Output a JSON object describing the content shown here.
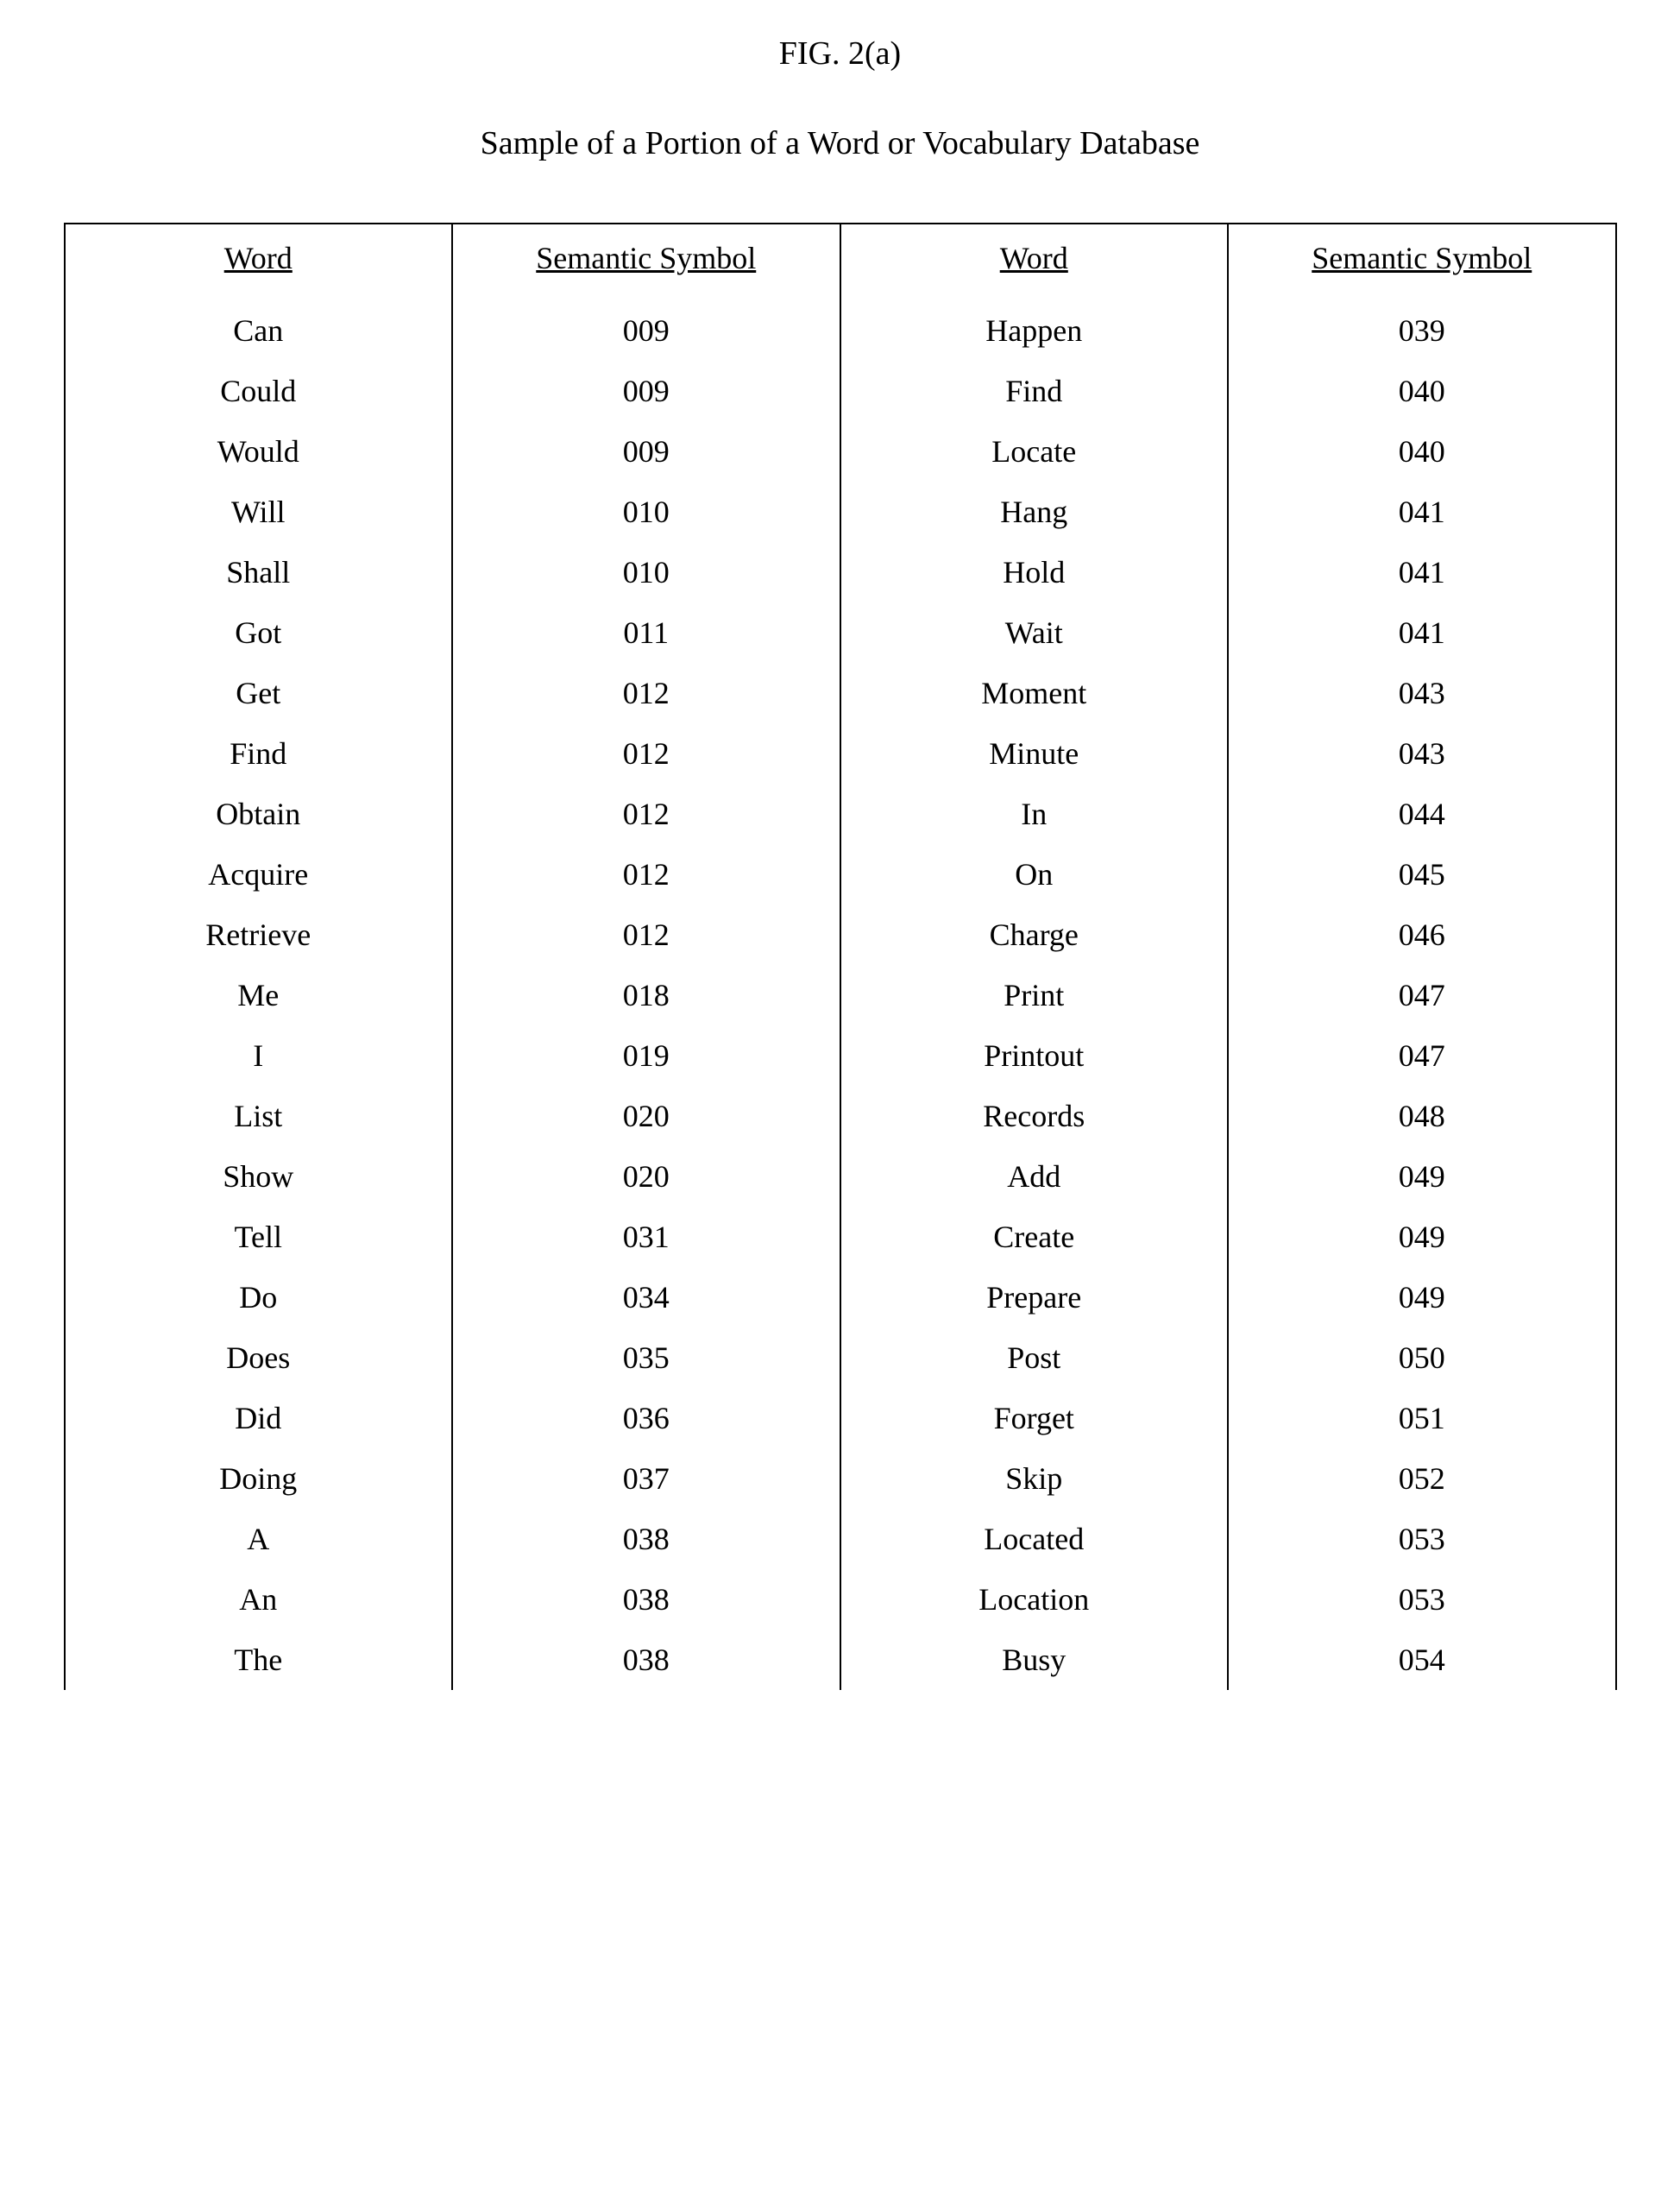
{
  "figure_label": "FIG. 2(a)",
  "title": "Sample of a Portion of a Word or Vocabulary Database",
  "headers": {
    "word_left": "Word",
    "symbol_left": "Semantic Symbol",
    "word_right": "Word",
    "symbol_right": "Semantic Symbol"
  },
  "rows": [
    {
      "w1": "Can",
      "s1": "009",
      "w2": "Happen",
      "s2": "039"
    },
    {
      "w1": "Could",
      "s1": "009",
      "w2": "Find",
      "s2": "040"
    },
    {
      "w1": "Would",
      "s1": "009",
      "w2": "Locate",
      "s2": "040"
    },
    {
      "w1": "Will",
      "s1": "010",
      "w2": "Hang",
      "s2": "041"
    },
    {
      "w1": "Shall",
      "s1": "010",
      "w2": "Hold",
      "s2": "041"
    },
    {
      "w1": "Got",
      "s1": "011",
      "w2": "Wait",
      "s2": "041"
    },
    {
      "w1": "Get",
      "s1": "012",
      "w2": "Moment",
      "s2": "043"
    },
    {
      "w1": "Find",
      "s1": "012",
      "w2": "Minute",
      "s2": "043"
    },
    {
      "w1": "Obtain",
      "s1": "012",
      "w2": "In",
      "s2": "044"
    },
    {
      "w1": "Acquire",
      "s1": "012",
      "w2": "On",
      "s2": "045"
    },
    {
      "w1": "Retrieve",
      "s1": "012",
      "w2": "Charge",
      "s2": "046"
    },
    {
      "w1": "Me",
      "s1": "018",
      "w2": "Print",
      "s2": "047"
    },
    {
      "w1": "I",
      "s1": "019",
      "w2": "Printout",
      "s2": "047"
    },
    {
      "w1": "List",
      "s1": "020",
      "w2": "Records",
      "s2": "048"
    },
    {
      "w1": "Show",
      "s1": "020",
      "w2": "Add",
      "s2": "049"
    },
    {
      "w1": "Tell",
      "s1": "031",
      "w2": "Create",
      "s2": "049"
    },
    {
      "w1": "Do",
      "s1": "034",
      "w2": "Prepare",
      "s2": "049"
    },
    {
      "w1": "Does",
      "s1": "035",
      "w2": "Post",
      "s2": "050"
    },
    {
      "w1": "Did",
      "s1": "036",
      "w2": "Forget",
      "s2": "051"
    },
    {
      "w1": "Doing",
      "s1": "037",
      "w2": "Skip",
      "s2": "052"
    },
    {
      "w1": "A",
      "s1": "038",
      "w2": "Located",
      "s2": "053"
    },
    {
      "w1": "An",
      "s1": "038",
      "w2": "Location",
      "s2": "053"
    },
    {
      "w1": "The",
      "s1": "038",
      "w2": "Busy",
      "s2": "054"
    }
  ]
}
